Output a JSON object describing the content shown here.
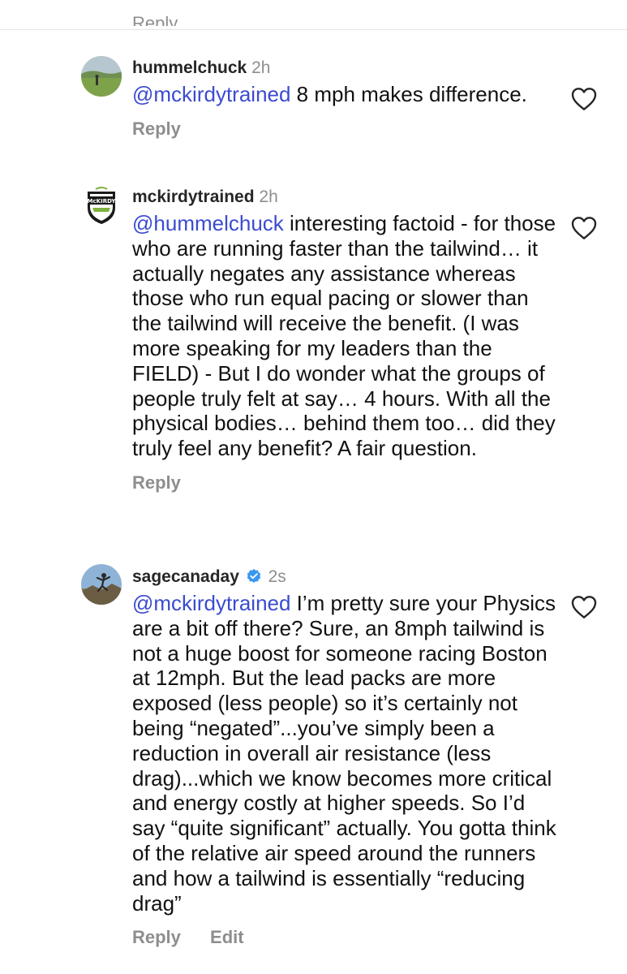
{
  "partial_reply_label": "Reply",
  "comments": [
    {
      "username": "hummelchuck",
      "time": "2h",
      "mention": "@mckirdytrained",
      "text": " 8 mph makes difference.",
      "reply_label": "Reply",
      "avatar_icon": "profile-photo-field"
    },
    {
      "username": "mckirdytrained",
      "time": "2h",
      "mention": "@hummelchuck",
      "text": " interesting factoid - for those who are running faster than the tailwind… it actually negates any assistance whereas those who run equal pacing or slower than the tailwind will receive the benefit. (I was more speaking for my leaders than the FIELD) - But I do wonder what the groups of people truly felt at say… 4 hours. With all the physical bodies… behind them too… did they truly feel any benefit? A fair question.",
      "reply_label": "Reply",
      "avatar_icon": "mckirdy-logo",
      "avatar_text": "McKIRDY"
    },
    {
      "username": "sagecanaday",
      "time": "2s",
      "verified": true,
      "mention": "@mckirdytrained",
      "text": " I’m pretty sure your Physics are a bit off there? Sure, an 8mph tailwind is not a huge boost for someone racing Boston at 12mph. But the lead packs are more exposed (less people) so it’s certainly not being “negated”...you’ve simply been a reduction in overall air resistance (less drag)...which we know becomes more critical and energy costly at higher speeds. So I’d say “quite significant” actually. You gotta think of the relative air speed around the runners and how a tailwind is essentially “reducing drag”",
      "reply_label": "Reply",
      "edit_label": "Edit",
      "avatar_icon": "profile-photo-runner"
    }
  ],
  "colors": {
    "mention": "#3b4bd0",
    "secondary_text": "#8e8e8e",
    "verified_badge": "#3897f0"
  }
}
